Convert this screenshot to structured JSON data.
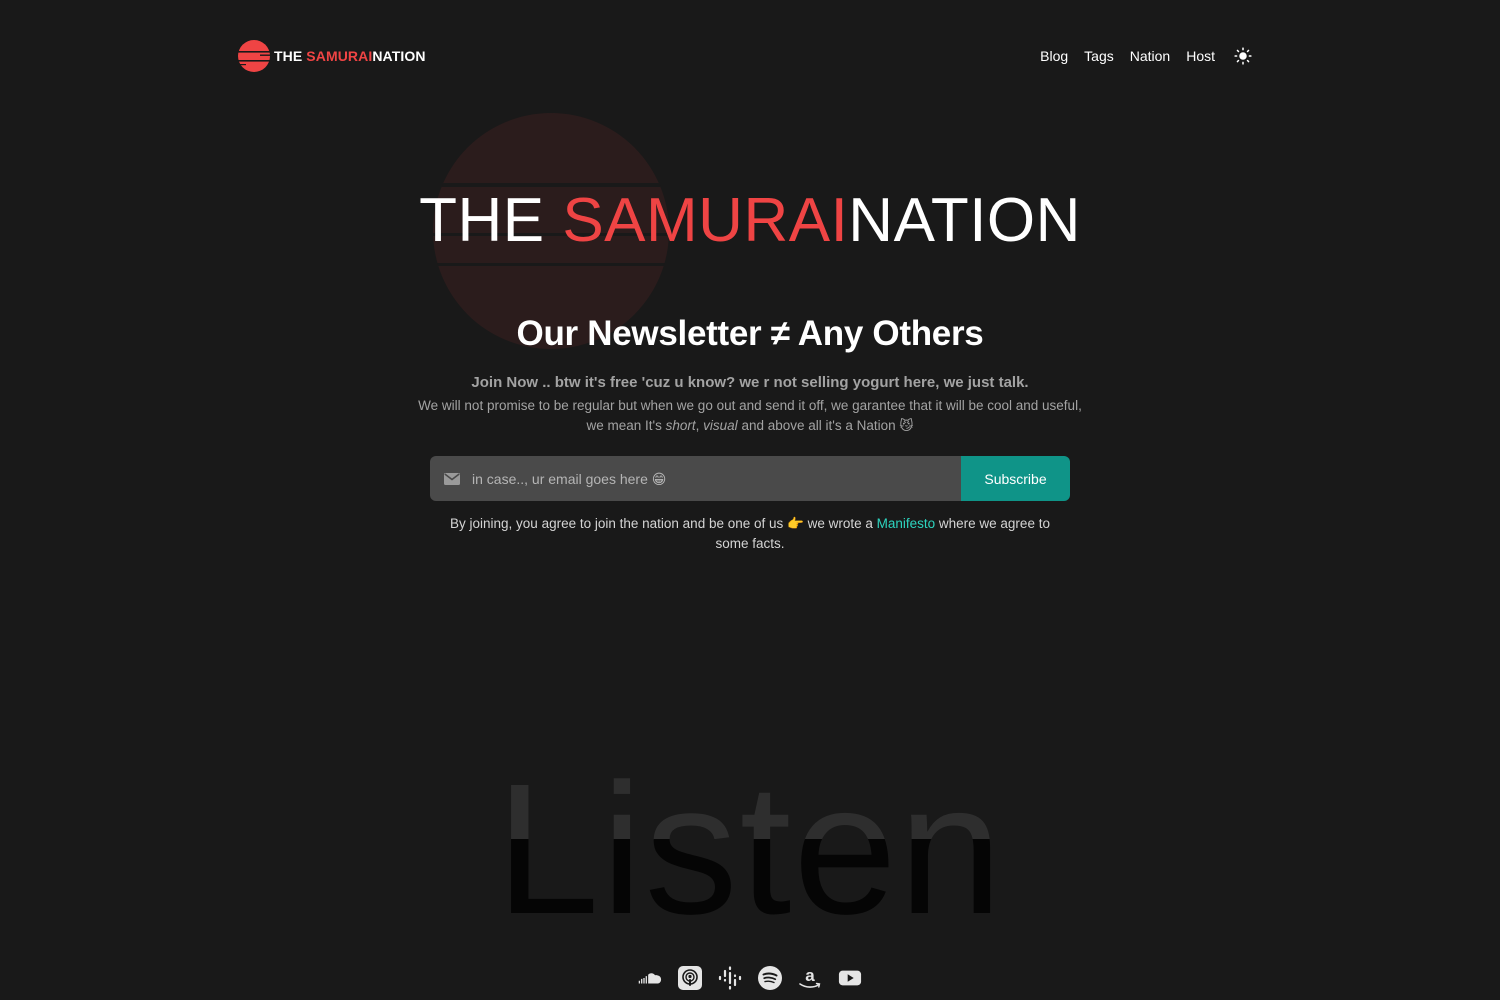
{
  "nav": {
    "brand": {
      "part1": "THE ",
      "part2": "SAMURAI",
      "part3": "NATION"
    },
    "links": [
      "Blog",
      "Tags",
      "Nation",
      "Host"
    ],
    "theme_icon": "sun-icon"
  },
  "hero": {
    "title_part1": "THE ",
    "title_part2": "SAMURAI",
    "title_part3": "NATION"
  },
  "newsletter": {
    "heading": "Our Newsletter ≠ Any Others",
    "join_line": "Join Now .. btw it's free 'cuz u know? we r not selling yogurt here, we just talk.",
    "promise_1": "We will not promise to be regular but when we go out and send it off, we garantee that it will be cool and useful, we mean It's ",
    "promise_short": "short",
    "promise_sep": ", ",
    "promise_visual": "visual",
    "promise_2": " and above all it's a Nation 😼",
    "email_placeholder": "in case.., ur email goes here 😁",
    "subscribe_label": "Subscribe",
    "agree_1": "By joining, you agree to join the nation and be one of us 👉 we wrote a ",
    "agree_link": "Manifesto",
    "agree_2": " where we agree to some facts."
  },
  "listen": {
    "heading": "Listen",
    "platforms": [
      "soundcloud-icon",
      "apple-podcasts-icon",
      "google-podcasts-icon",
      "spotify-icon",
      "amazon-icon",
      "youtube-icon"
    ]
  },
  "colors": {
    "background": "#191919",
    "accent_red": "#ef4444",
    "teal_button": "#0f9488",
    "teal_link": "#2dd4bf"
  }
}
